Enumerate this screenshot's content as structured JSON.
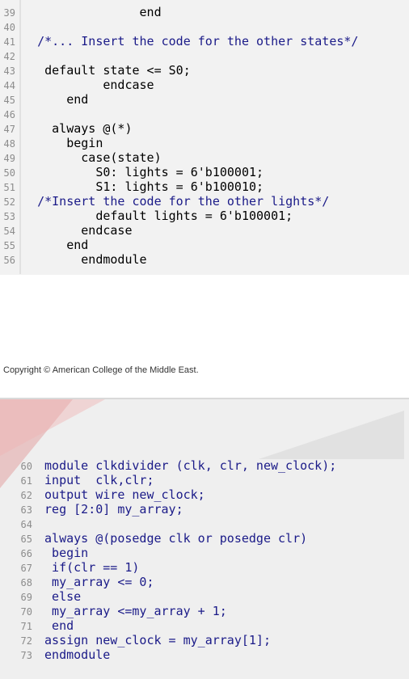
{
  "code1": {
    "lines": [
      {
        "n": "39",
        "pre": "               ",
        "t": "end"
      },
      {
        "n": "40",
        "pre": "",
        "t": ""
      },
      {
        "n": "41",
        "pre": " ",
        "t": "/*... Insert the code for the other states*/"
      },
      {
        "n": "42",
        "pre": "",
        "t": ""
      },
      {
        "n": "43",
        "pre": "  ",
        "t": "default state <= S0;"
      },
      {
        "n": "44",
        "pre": "          ",
        "t": "endcase"
      },
      {
        "n": "45",
        "pre": "     ",
        "t": "end"
      },
      {
        "n": "46",
        "pre": "",
        "t": ""
      },
      {
        "n": "47",
        "pre": "   ",
        "t": "always @(*)"
      },
      {
        "n": "48",
        "pre": "     ",
        "t": "begin"
      },
      {
        "n": "49",
        "pre": "       ",
        "t": "case(state)"
      },
      {
        "n": "50",
        "pre": "         ",
        "t": "S0: lights = 6'b100001;"
      },
      {
        "n": "51",
        "pre": "         ",
        "t": "S1: lights = 6'b100010;"
      },
      {
        "n": "52",
        "pre": " ",
        "t": "/*Insert the code for the other lights*/"
      },
      {
        "n": "53",
        "pre": "         ",
        "t": "default lights = 6'b100001;"
      },
      {
        "n": "54",
        "pre": "       ",
        "t": "endcase"
      },
      {
        "n": "55",
        "pre": "     ",
        "t": "end"
      },
      {
        "n": "56",
        "pre": "       ",
        "t": "endmodule"
      }
    ]
  },
  "copyright": "Copyright © American College of the Middle East.",
  "code2": {
    "lines": [
      {
        "n": "60",
        "t": "module clkdivider (clk, clr, new_clock);"
      },
      {
        "n": "61",
        "t": "input  clk,clr;"
      },
      {
        "n": "62",
        "t": "output wire new_clock;"
      },
      {
        "n": "63",
        "t": "reg [2:0] my_array;"
      },
      {
        "n": "64",
        "t": ""
      },
      {
        "n": "65",
        "t": "always @(posedge clk or posedge clr)"
      },
      {
        "n": "66",
        "t": " begin"
      },
      {
        "n": "67",
        "t": " if(clr == 1)"
      },
      {
        "n": "68",
        "t": " my_array <= 0;"
      },
      {
        "n": "69",
        "t": " else"
      },
      {
        "n": "70",
        "t": " my_array <=my_array + 1;"
      },
      {
        "n": "71",
        "t": " end"
      },
      {
        "n": "72",
        "t": "assign new_clock = my_array[1];"
      },
      {
        "n": "73",
        "t": "endmodule"
      }
    ]
  }
}
